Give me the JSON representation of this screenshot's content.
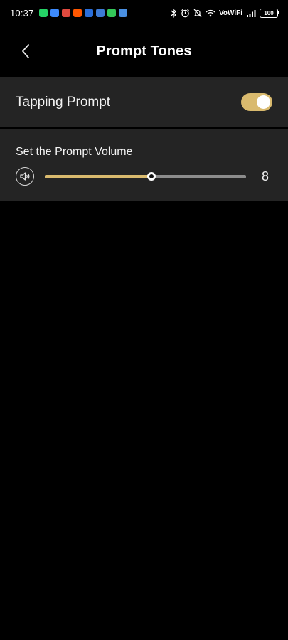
{
  "status_bar": {
    "time": "10:37",
    "app_icons": [
      {
        "name": "whatsapp-icon",
        "color": "#25d366"
      },
      {
        "name": "youtube-icon",
        "color": "#3d8bfd"
      },
      {
        "name": "gmail-icon",
        "color": "#e04a3f"
      },
      {
        "name": "reddit-icon",
        "color": "#ff5700"
      },
      {
        "name": "tv-icon",
        "color": "#2a6fdb"
      },
      {
        "name": "mail-icon",
        "color": "#3d7bd6"
      },
      {
        "name": "messenger-icon",
        "color": "#34c759"
      },
      {
        "name": "files-icon",
        "color": "#4a90e2"
      }
    ],
    "network_label": "VoWiFi",
    "battery": "100"
  },
  "header": {
    "title": "Prompt Tones"
  },
  "tapping_prompt": {
    "label": "Tapping Prompt",
    "enabled": true
  },
  "volume": {
    "title": "Set the Prompt Volume",
    "value": "8",
    "level_fraction": 0.53
  },
  "colors": {
    "accent": "#d9ba6e",
    "row_background": "#242424",
    "background": "#000000"
  }
}
